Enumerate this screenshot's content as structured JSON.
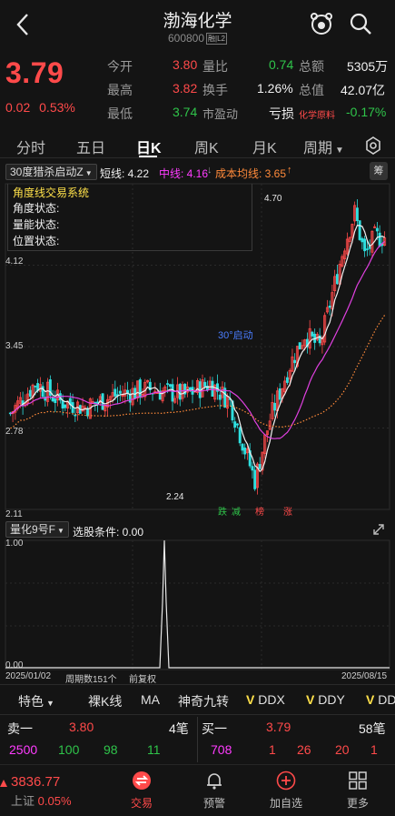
{
  "header": {
    "title": "渤海化学",
    "code": "600800",
    "code_tag": "融|L2"
  },
  "quote": {
    "price": "3.79",
    "change": "0.02",
    "change_pct": "0.53%",
    "stats": [
      {
        "label": "今开",
        "value": "3.80",
        "color": "red"
      },
      {
        "label": "量比",
        "value": "0.74",
        "color": "green"
      },
      {
        "label": "总额",
        "value": "5305万",
        "color": "white"
      },
      {
        "label": "最高",
        "value": "3.82",
        "color": "red"
      },
      {
        "label": "换手",
        "value": "1.26%",
        "color": "white"
      },
      {
        "label": "总值",
        "value": "42.07亿",
        "color": "white"
      },
      {
        "label": "最低",
        "value": "3.74",
        "color": "green"
      },
      {
        "label": "市盈动",
        "value": "亏损",
        "color": "white"
      },
      {
        "label": "化学原料",
        "value": "-0.17%",
        "color": "green"
      }
    ]
  },
  "period_tabs": [
    "分时",
    "五日",
    "日K",
    "周K",
    "月K",
    "周期"
  ],
  "active_period": "日K",
  "indicator": {
    "selector": "30度猎杀启动Z",
    "short_line": "短线: 4.22",
    "mid_line": "中线: 4.16",
    "cost_line": "成本均线: 3.65",
    "chou": "筹"
  },
  "chart": {
    "y_labels": [
      "4.12",
      "3.45",
      "2.78",
      "2.11"
    ],
    "high_label": "4.70",
    "low_label": "2.24",
    "annotation": "30°启动",
    "status_title": "角度线交易系统",
    "status_rows": [
      "角度状态:",
      "量能状态:",
      "位置状态:"
    ],
    "markers": [
      "跌",
      "减",
      "榜",
      "涨"
    ]
  },
  "sub_chart": {
    "selector": "量化9号F",
    "condition": "选股条件: 0.00",
    "y_top": "1.00",
    "y_bottom": "0.00"
  },
  "dates": {
    "start": "2025/01/02",
    "period_count": "周期数151个",
    "adjust": "前复权",
    "end": "2025/08/15"
  },
  "indicator_tabs": [
    "特色",
    "裸K线",
    "MA",
    "神奇九转",
    "DDX",
    "DDY",
    "DDZ"
  ],
  "book": {
    "sell_label": "卖一",
    "sell_price": "3.80",
    "sell_count": "4笔",
    "buy_label": "买一",
    "buy_price": "3.79",
    "buy_count": "58笔",
    "sell_sizes": [
      "2500",
      "100",
      "98",
      "11"
    ],
    "buy_sizes": [
      "708",
      "1",
      "26",
      "20",
      "1"
    ]
  },
  "nav": {
    "index_value": "3836.77",
    "index_label": "上证",
    "index_pct": "0.05%",
    "items": [
      "交易",
      "预警",
      "加自选",
      "更多"
    ]
  },
  "colors": {
    "up": "#ff4a4a",
    "down": "#2fc44a",
    "background": "#141414",
    "mid_line": "#e040e0",
    "cost_line": "#ff8a3a"
  }
}
